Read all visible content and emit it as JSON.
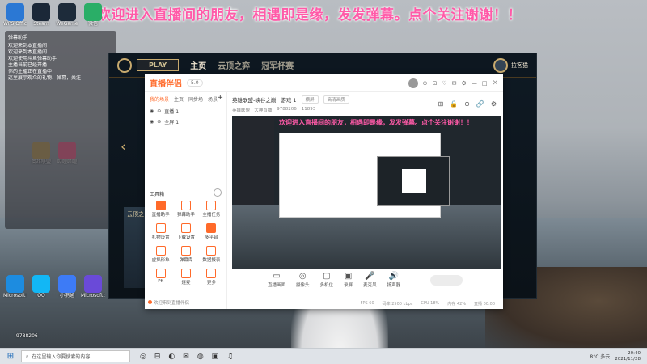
{
  "banner": "欢迎进入直播间的朋友，相遇即是缘，发发弹幕。点个关注谢谢！！",
  "desktop_icons": [
    {
      "label": "WPS Office",
      "color": "#2b78d4"
    },
    {
      "label": "Steam",
      "color": "#1b2838"
    },
    {
      "label": "WeGame",
      "color": "#1d2b3a"
    },
    {
      "label": "微信",
      "color": "#2aae67"
    },
    {
      "label": "英雄联盟",
      "color": "#c8aa6e"
    },
    {
      "label": "哔哩哔哩",
      "color": "#fb7299"
    },
    {
      "label": "Microsoft Edge",
      "color": "#1d8ce0"
    },
    {
      "label": "QQ",
      "color": "#12b7f5"
    },
    {
      "label": "小鹅通",
      "color": "#3d7bf6"
    },
    {
      "label": "Microsoft Store",
      "color": "#6a4ad8"
    }
  ],
  "chat_panel": {
    "header": "弹幕助手",
    "messages": [
      "欢迎来到本直播间",
      "欢迎来到本直播间",
      "欢迎使用斗鱼弹幕助手",
      "主播当前已经开播",
      "你的主播正在直播中",
      "这里展示观众的礼物、弹幕，关注"
    ]
  },
  "game": {
    "play_label": "PLAY",
    "nav": [
      "主页",
      "云顶之弈",
      "冠军杯赛"
    ],
    "user": "拉客猫",
    "card_label": "云顶之",
    "chevron": "‹"
  },
  "app": {
    "brand": "直播伴侣",
    "version": "5.0",
    "titlebar_icons": [
      "⊙",
      "⊡",
      "♡",
      "✉",
      "⚙",
      "—",
      "□",
      "✕"
    ],
    "left_tabs": [
      "我的场景",
      "主页",
      "同步场",
      "场景"
    ],
    "left_tab_active_index": 0,
    "add_scene": "+",
    "scenes": [
      {
        "eye": "◉",
        "lock": "⊝",
        "name": "直播 1"
      },
      {
        "eye": "◉",
        "lock": "⊝",
        "name": "全屏 1"
      }
    ],
    "tools_title": "工具箱",
    "tools_more": "…",
    "tools": [
      {
        "label": "直播助手",
        "filled": true
      },
      {
        "label": "弹幕助手",
        "filled": false
      },
      {
        "label": "主播任务",
        "filled": false
      },
      {
        "label": "礼物设置",
        "filled": false
      },
      {
        "label": "下载设置",
        "filled": false
      },
      {
        "label": "多平台",
        "filled": true
      },
      {
        "label": "虚拟形象",
        "filled": false
      },
      {
        "label": "弹幕库",
        "filled": false
      },
      {
        "label": "数据报表",
        "filled": false
      },
      {
        "label": "PK",
        "filled": false
      },
      {
        "label": "连麦",
        "filled": false
      },
      {
        "label": "更多",
        "filled": false
      }
    ],
    "notice": "欢迎来到直播伴侣",
    "room_title": "英雄联盟-峡谷之巅",
    "room_mode": "游戏 1",
    "room_tag1": "横屏",
    "room_tag2": "高清画质",
    "room_category": "英雄联盟 · 大神直播",
    "room_id": "9788206",
    "room_viewers": "11893",
    "room_icons": [
      "⊞",
      "🔒",
      "⊙",
      "🔗",
      "⚙"
    ],
    "preview_banner": "欢迎进入直播间的朋友，相遇即是缘，发发弹幕。点个关注谢谢！！",
    "controls": [
      {
        "icon": "▭",
        "label": "直播画面"
      },
      {
        "icon": "◎",
        "label": "摄像头"
      },
      {
        "icon": "▢",
        "label": "多机位"
      },
      {
        "icon": "▣",
        "label": "录屏"
      },
      {
        "icon": "🎤",
        "label": "麦克风"
      },
      {
        "icon": "🔊",
        "label": "扬声器"
      }
    ],
    "status": [
      "FPS 60",
      "码率 2500 kbps",
      "CPU 18%",
      "内存 42%",
      "直播 00:00"
    ]
  },
  "taskbar": {
    "start": "⊞",
    "search_placeholder": "在这里输入你要搜索的内容",
    "apps": [
      "◎",
      "⊟",
      "◐",
      "✉",
      "◍",
      "▣",
      "♫"
    ],
    "weather": "8°C 多云",
    "time": "20:40",
    "date": "2021/11/28"
  },
  "streamer_id": "9788206"
}
